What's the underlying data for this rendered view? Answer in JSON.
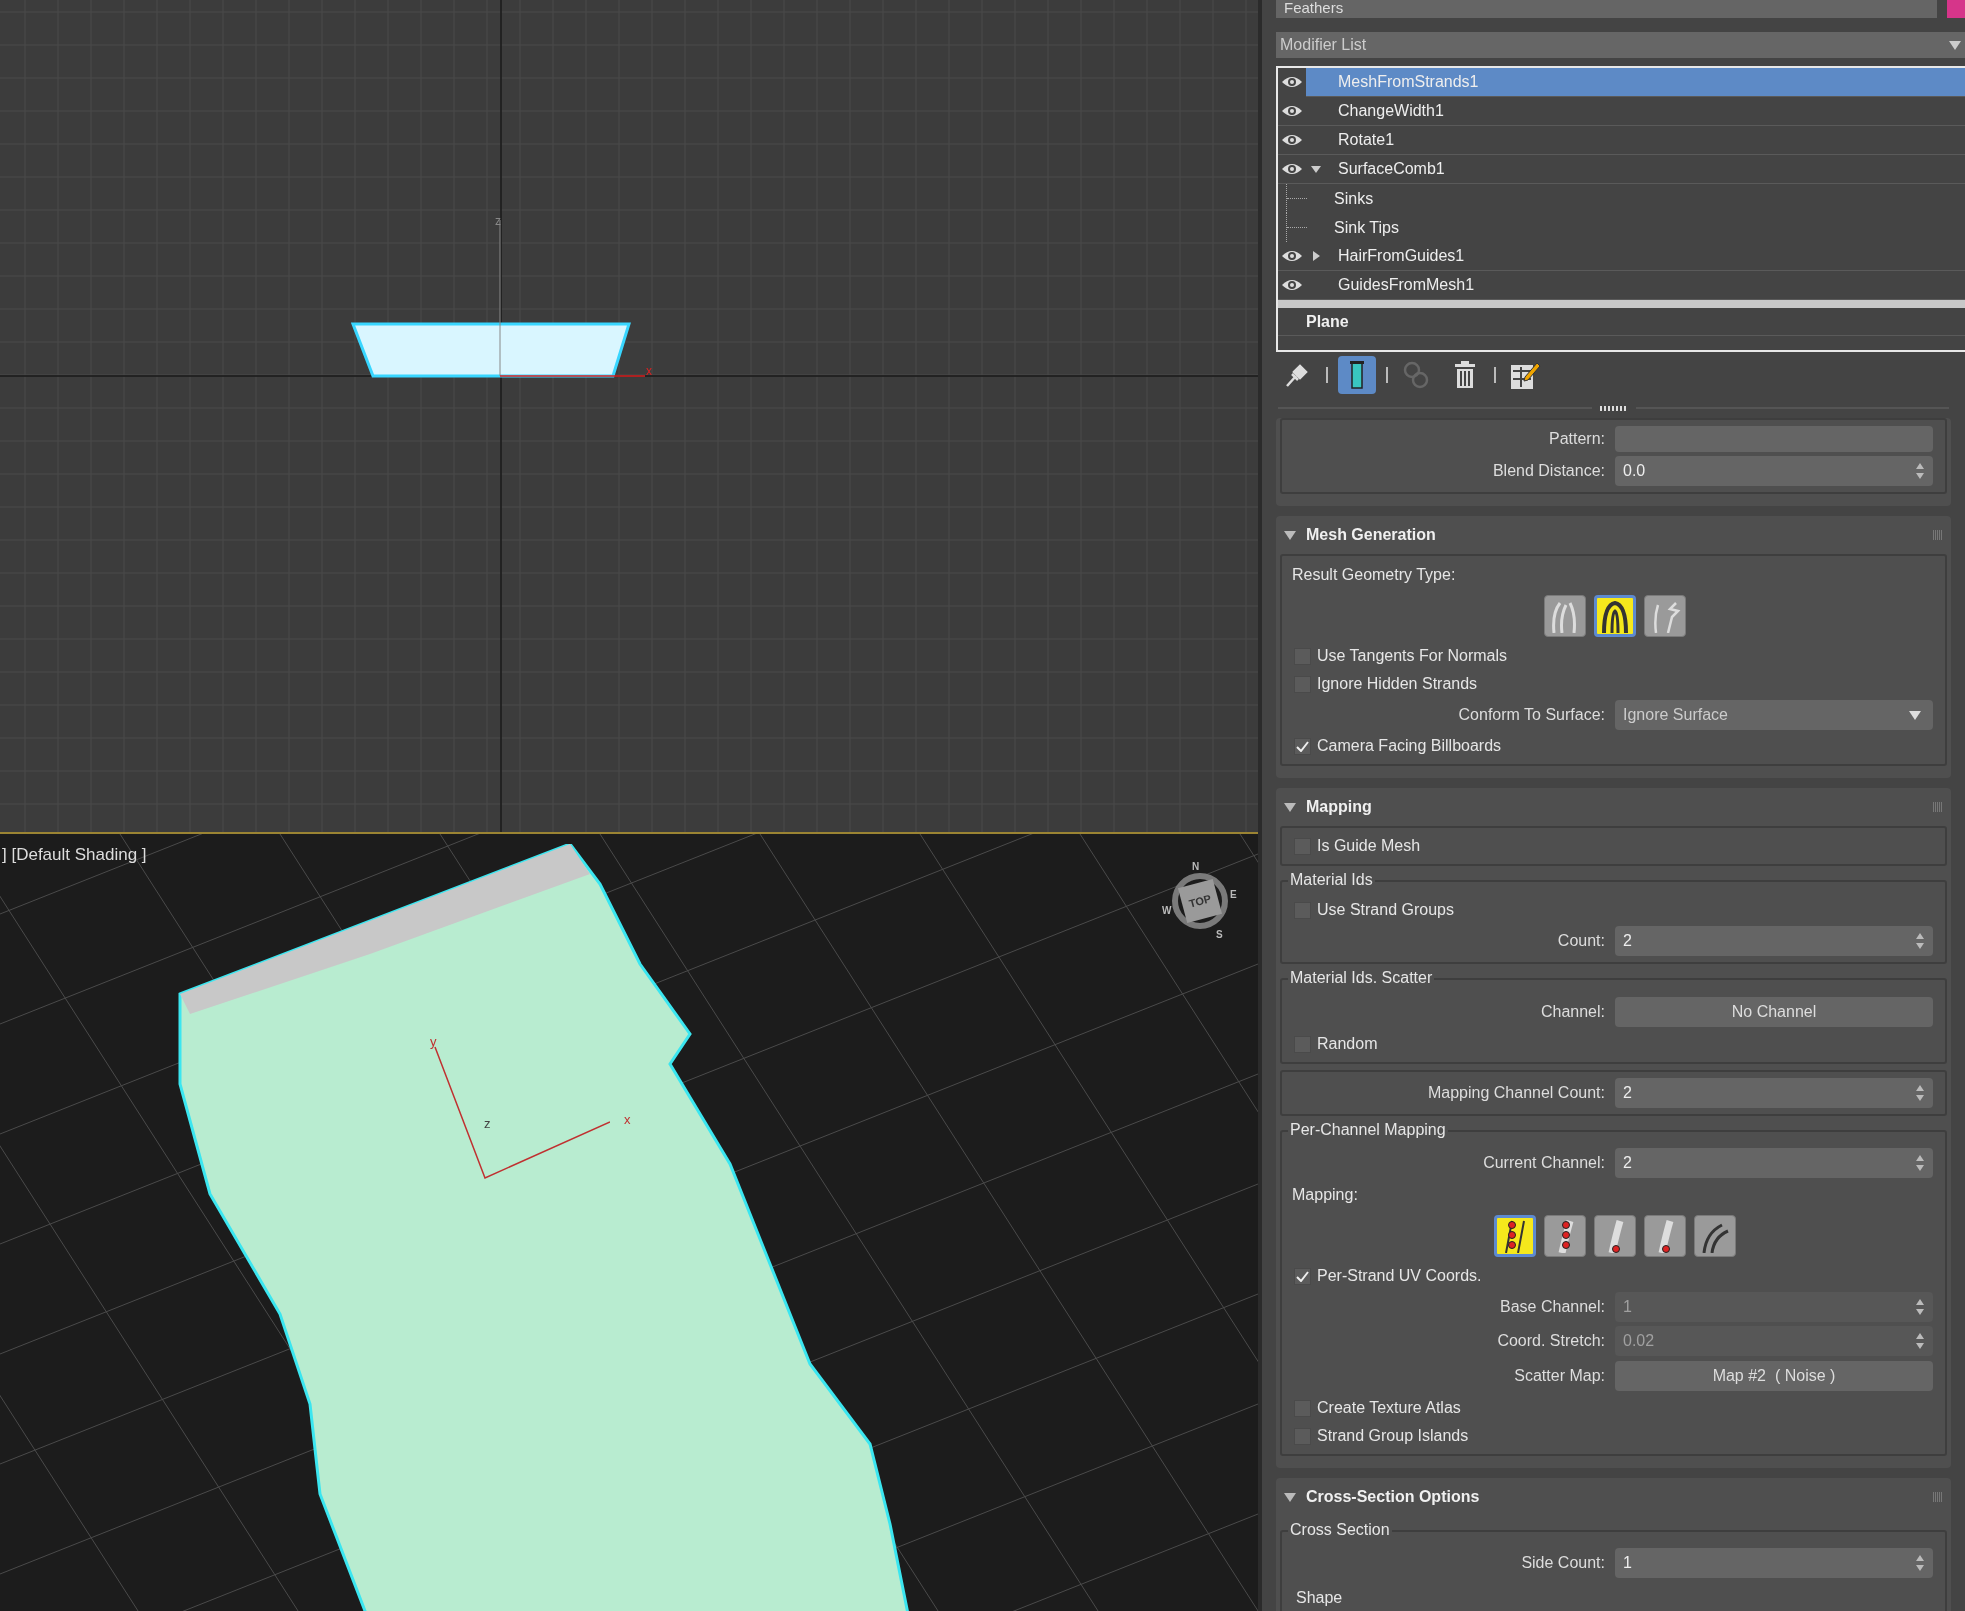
{
  "viewports": {
    "top": {
      "axis_labels": [
        "z",
        "x"
      ]
    },
    "perspective": {
      "label": "] [Default Shading ]",
      "active": true,
      "axis_labels": [
        "y",
        "z",
        "x"
      ],
      "viewcube": {
        "face": "TOP",
        "compass": [
          "N",
          "E",
          "S",
          "W"
        ]
      }
    }
  },
  "command_panel": {
    "object_name": "Feathers",
    "modifier_list": "Modifier List",
    "stack": [
      {
        "name": "MeshFromStrands1",
        "visible": true,
        "selected": true
      },
      {
        "name": "ChangeWidth1",
        "visible": true,
        "selected": false
      },
      {
        "name": "Rotate1",
        "visible": true,
        "selected": false
      },
      {
        "name": "SurfaceComb1",
        "visible": true,
        "selected": false,
        "expanded": true,
        "children": [
          {
            "name": "Sinks",
            "selected": false
          },
          {
            "name": "Sink Tips",
            "selected": false
          }
        ]
      },
      {
        "name": "HairFromGuides1",
        "visible": true,
        "selected": false,
        "expanded": false
      },
      {
        "name": "GuidesFromMesh1",
        "visible": true,
        "selected": false
      }
    ],
    "base_object": "Plane",
    "toolbar": [
      {
        "kind": "pin",
        "selected": false
      },
      {
        "kind": "end_result",
        "selected": true
      },
      {
        "kind": "make_unique",
        "selected": false
      },
      {
        "kind": "remove",
        "selected": false
      },
      {
        "kind": "configure",
        "selected": false
      }
    ],
    "rollouts": [
      {
        "groups": [
          {
            "items": [
              {
                "kind": "text_field",
                "label": "Pattern:"
              },
              {
                "kind": "spinner",
                "label": "Blend Distance:",
                "value": "0.0",
                "disabled": false
              }
            ]
          }
        ]
      },
      {
        "title": "Mesh Generation",
        "expanded": true,
        "groups": [
          {
            "items": [
              {
                "kind": "label",
                "text": "Result Geometry Type:"
              },
              {
                "kind": "geometry_choice",
                "options": [
                  {
                    "selected": false
                  },
                  {
                    "selected": true
                  },
                  {
                    "selected": false
                  }
                ]
              },
              {
                "kind": "checkbox",
                "label": "Use Tangents For Normals",
                "checked": false
              },
              {
                "kind": "checkbox",
                "label": "Ignore Hidden Strands",
                "checked": false
              },
              {
                "kind": "dropdown",
                "label": "Conform To Surface:",
                "value": "Ignore Surface"
              },
              {
                "kind": "checkbox",
                "label": "Camera Facing Billboards",
                "checked": true
              }
            ]
          }
        ]
      },
      {
        "title": "Mapping",
        "expanded": true,
        "groups": [
          {
            "items": [
              {
                "kind": "checkbox",
                "label": "Is Guide Mesh",
                "checked": false
              }
            ]
          },
          {
            "title": "Material Ids",
            "items": [
              {
                "kind": "checkbox",
                "label": "Use Strand Groups",
                "checked": false
              },
              {
                "kind": "spinner",
                "label": "Count:",
                "value": "2",
                "disabled": false
              }
            ]
          },
          {
            "title": "Material Ids. Scatter",
            "items": [
              {
                "kind": "map_button",
                "label": "Channel:",
                "value": "No Channel"
              },
              {
                "kind": "checkbox",
                "label": "Random",
                "checked": false
              }
            ]
          },
          {
            "items": [
              {
                "kind": "spinner",
                "label": "Mapping Channel Count:",
                "value": "2",
                "disabled": false
              }
            ]
          },
          {
            "title": "Per-Channel Mapping",
            "items": [
              {
                "kind": "spinner",
                "label": "Current Channel:",
                "value": "2",
                "disabled": false
              },
              {
                "kind": "label",
                "text": "Mapping:"
              },
              {
                "kind": "mapping_choice",
                "options": [
                  {
                    "selected": true
                  },
                  {
                    "selected": false
                  },
                  {
                    "selected": false
                  },
                  {
                    "selected": false
                  },
                  {
                    "selected": false
                  }
                ]
              },
              {
                "kind": "checkbox",
                "label": "Per-Strand UV Coords.",
                "checked": true
              },
              {
                "kind": "spinner",
                "label": "Base Channel:",
                "value": "1",
                "disabled": true
              },
              {
                "kind": "spinner",
                "label": "Coord. Stretch:",
                "value": "0.02",
                "disabled": true
              },
              {
                "kind": "map_button",
                "label": "Scatter Map:",
                "value": "Map #2  ( Noise )"
              },
              {
                "kind": "checkbox",
                "label": "Create Texture Atlas",
                "checked": false
              },
              {
                "kind": "checkbox",
                "label": "Strand Group Islands",
                "checked": false
              }
            ]
          }
        ]
      },
      {
        "title": "Cross-Section Options",
        "expanded": true,
        "groups": [
          {
            "title": "Cross Section",
            "items": [
              {
                "kind": "spinner",
                "label": "Side Count:",
                "value": "1",
                "disabled": false
              },
              {
                "kind": "shape_box",
                "label": "Shape"
              }
            ]
          }
        ]
      }
    ]
  }
}
